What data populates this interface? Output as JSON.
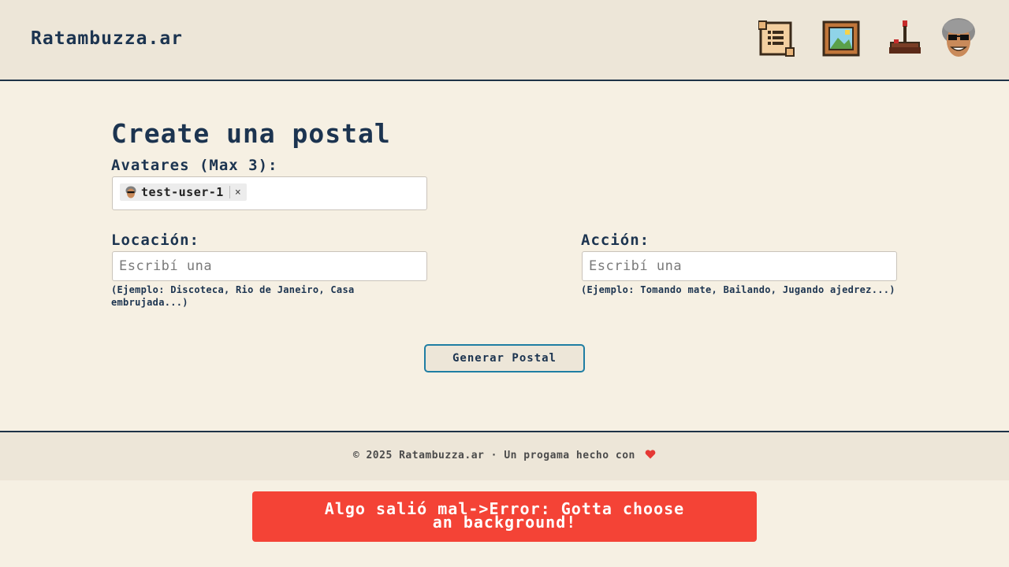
{
  "header": {
    "brand": "Ratambuzza.ar",
    "nav": [
      {
        "icon": "scroll-icon"
      },
      {
        "icon": "picture-frame-icon"
      },
      {
        "icon": "joystick-icon"
      },
      {
        "icon": "user-avatar-icon"
      }
    ]
  },
  "main": {
    "title": "Create una postal",
    "avatars": {
      "label": "Avatares (Max 3):",
      "selected": [
        {
          "label": "test-user-1",
          "remove_icon": "close-icon"
        }
      ],
      "remove_glyph": "×"
    },
    "location": {
      "label": "Locación:",
      "placeholder": "Escribí una",
      "value": "",
      "hint": "(Ejemplo: Discoteca, Rio de Janeiro, Casa embrujada...)"
    },
    "action": {
      "label": "Acción:",
      "placeholder": "Escribí una",
      "value": "",
      "hint": "(Ejemplo: Tomando mate, Bailando, Jugando ajedrez...)"
    },
    "generate_label": "Generar Postal"
  },
  "footer": {
    "text": "© 2025 Ratambuzza.ar · Un progama hecho con",
    "heart_icon": "heart-icon"
  },
  "error": {
    "line1": "Algo salió mal->Error: Gotta choose",
    "line2": "an background!"
  },
  "colors": {
    "background": "#f6f0e3",
    "header_bg": "#ede6d8",
    "text": "#1c3450",
    "button_border": "#1f7ea3",
    "error_bg": "#f44336"
  }
}
